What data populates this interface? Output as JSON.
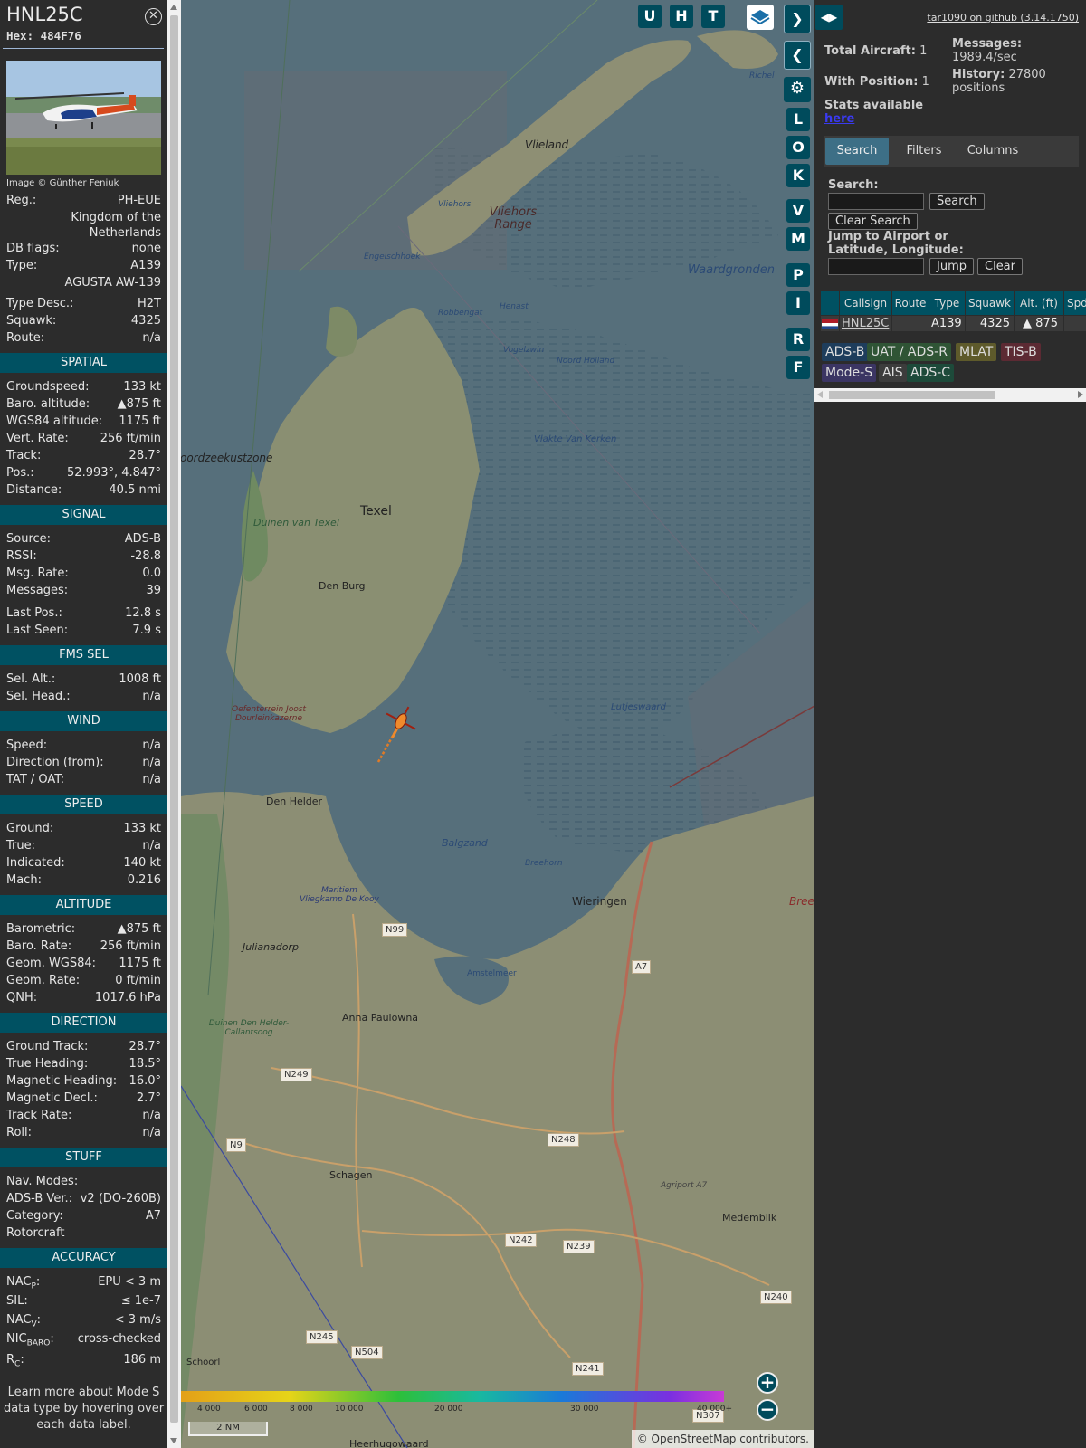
{
  "aircraft": {
    "callsign": "HNL25C",
    "hex": "Hex: 484F76",
    "image_credit": "Image © Günther Feniuk"
  },
  "info": [
    {
      "k": "Reg.:",
      "v": "PH-EUE"
    },
    {
      "k": "",
      "v": "Kingdom of the"
    },
    {
      "k": "",
      "v": "Netherlands"
    },
    {
      "k": "DB flags:",
      "v": "none"
    },
    {
      "k": "Type:",
      "v": "A139"
    },
    {
      "k": "",
      "v": "AGUSTA AW-139"
    },
    {
      "k": "Type Desc.:",
      "v": "H2T"
    },
    {
      "k": "Squawk:",
      "v": "4325"
    },
    {
      "k": "Route:",
      "v": "n/a"
    }
  ],
  "sections": {
    "spatial": "SPATIAL",
    "signal": "SIGNAL",
    "fms": "FMS SEL",
    "wind": "WIND",
    "speed": "SPEED",
    "altitude": "ALTITUDE",
    "direction": "DIRECTION",
    "stuff": "STUFF",
    "accuracy": "ACCURACY"
  },
  "spatial": [
    {
      "k": "Groundspeed:",
      "v": "133 kt"
    },
    {
      "k": "Baro. altitude:",
      "v": "▲875 ft"
    },
    {
      "k": "WGS84 altitude:",
      "v": "1175 ft"
    },
    {
      "k": "Vert. Rate:",
      "v": "256 ft/min"
    },
    {
      "k": "Track:",
      "v": "28.7°"
    },
    {
      "k": "Pos.:",
      "v": "52.993°, 4.847°"
    },
    {
      "k": "Distance:",
      "v": "40.5 nmi"
    }
  ],
  "signal": [
    {
      "k": "Source:",
      "v": "ADS-B"
    },
    {
      "k": "RSSI:",
      "v": "-28.8"
    },
    {
      "k": "Msg. Rate:",
      "v": "0.0"
    },
    {
      "k": "Messages:",
      "v": "39"
    },
    {
      "k": "Last Pos.:",
      "v": "12.8 s"
    },
    {
      "k": "Last Seen:",
      "v": "7.9 s"
    }
  ],
  "fms": [
    {
      "k": "Sel. Alt.:",
      "v": "1008 ft"
    },
    {
      "k": "Sel. Head.:",
      "v": "n/a"
    }
  ],
  "wind": [
    {
      "k": "Speed:",
      "v": "n/a"
    },
    {
      "k": "Direction (from):",
      "v": "n/a"
    },
    {
      "k": "TAT / OAT:",
      "v": "n/a"
    }
  ],
  "speed": [
    {
      "k": "Ground:",
      "v": "133 kt"
    },
    {
      "k": "True:",
      "v": "n/a"
    },
    {
      "k": "Indicated:",
      "v": "140 kt"
    },
    {
      "k": "Mach:",
      "v": "0.216"
    }
  ],
  "altitude": [
    {
      "k": "Barometric:",
      "v": "▲875 ft"
    },
    {
      "k": "Baro. Rate:",
      "v": "256 ft/min"
    },
    {
      "k": "Geom. WGS84:",
      "v": "1175 ft"
    },
    {
      "k": "Geom. Rate:",
      "v": "0 ft/min"
    },
    {
      "k": "QNH:",
      "v": "1017.6 hPa"
    }
  ],
  "direction": [
    {
      "k": "Ground Track:",
      "v": "28.7°"
    },
    {
      "k": "True Heading:",
      "v": "18.5°"
    },
    {
      "k": "Magnetic Heading:",
      "v": "16.0°"
    },
    {
      "k": "Magnetic Decl.:",
      "v": "2.7°"
    },
    {
      "k": "Track Rate:",
      "v": "n/a"
    },
    {
      "k": "Roll:",
      "v": "n/a"
    }
  ],
  "stuff": [
    {
      "k": "Nav. Modes:",
      "v": ""
    },
    {
      "k": "ADS-B Ver.:",
      "v": "v2 (DO-260B)"
    },
    {
      "k": "Category:",
      "v": "A7"
    },
    {
      "k": "Rotorcraft",
      "v": ""
    }
  ],
  "accuracy": [
    {
      "k": "NAC",
      "sub": "P",
      "v": "EPU < 3 m"
    },
    {
      "k": "SIL:",
      "sub": "",
      "v": "≤ 1e-7"
    },
    {
      "k": "NAC",
      "sub": "V",
      "v": "< 3 m/s"
    },
    {
      "k": "NIC",
      "sub": "BARO",
      "v": "cross-checked"
    },
    {
      "k": "R",
      "sub": "C",
      "v": "186 m"
    }
  ],
  "footer": [
    "Learn more about Mode S",
    "data type by hovering over",
    "each data label."
  ],
  "map": {
    "labels": [
      "Vlieland",
      "Vliehors Range",
      "Waardgronden",
      "Noordzeekustzone",
      "Texel",
      "Duinen van Texel",
      "Den Burg",
      "Vlakte Van Kerken",
      "Lutjeswaard",
      "Oefenterrein Joost Dourleinkazerne",
      "Den Helder",
      "Balgzand",
      "Breehorn",
      "Wieringen",
      "Maritiem Vliegkamp De Kooy",
      "Julianadorp",
      "Amstelmeer",
      "Anna Paulowna",
      "Schagen",
      "Medemblik",
      "Schoorl",
      "Heerhugowaard",
      "Vliehors",
      "Engelschhoek",
      "Robbengat",
      "Henast",
      "Vogelzwin",
      "Noord Holland",
      "Richel",
      "Duinen Den Helder-Callantsoog",
      "Agriport A7",
      "Bree"
    ],
    "roads": [
      "N99",
      "N249",
      "N9",
      "N248",
      "N242",
      "N239",
      "N245",
      "N504",
      "N241",
      "N240",
      "A7",
      "N307"
    ],
    "scale_ticks": [
      "4 000",
      "6 000",
      "8 000",
      "10 000",
      "20 000",
      "30 000",
      "40 000+"
    ],
    "scale_label": "2 NM",
    "attribution": "© OpenStreetMap contributors.",
    "zoom_in": "+",
    "zoom_out": "−"
  },
  "map_buttons": [
    "U",
    "H",
    "T",
    "L",
    "O",
    "K",
    "V",
    "M",
    "P",
    "I",
    "R",
    "F"
  ],
  "stats": {
    "total_label": "Total Aircraft:",
    "total": "1",
    "pos_label": "With Position:",
    "pos": "1",
    "msg_label": "Messages:",
    "msg": "1989.4/sec",
    "hist_label": "History:",
    "hist": "27800 positions",
    "stats_label": "Stats available",
    "stats_link": "here",
    "github": "tar1090 on github (3.14.1750)"
  },
  "tabs": [
    "Search",
    "Filters",
    "Columns"
  ],
  "search": {
    "label": "Search:",
    "btn": "Search",
    "clear": "Clear Search",
    "jump_label": "Jump to Airport or Latitude, Longitude:",
    "jump": "Jump",
    "clear2": "Clear"
  },
  "table": {
    "headers": [
      "Callsign",
      "Route",
      "Type",
      "Squawk",
      "Alt. (ft)",
      "Spd"
    ],
    "row": {
      "callsign": "HNL25C",
      "route": "",
      "type": "A139",
      "squawk": "4325",
      "alt": "▲ 875"
    }
  },
  "sources": [
    "ADS-B",
    "UAT / ADS-R",
    "MLAT",
    "TIS-B",
    "Mode-S",
    "AIS",
    "ADS-C"
  ],
  "colors": {
    "header_teal": "#005162",
    "src_adsb": "#1e3d5c",
    "src_uat": "#2f5435",
    "src_mlat": "#5e5a2b",
    "src_tisb": "#5c2a33",
    "src_modes": "#3b3563",
    "src_ais": "#3c3c3c",
    "src_adsc": "#1d4a3a"
  }
}
